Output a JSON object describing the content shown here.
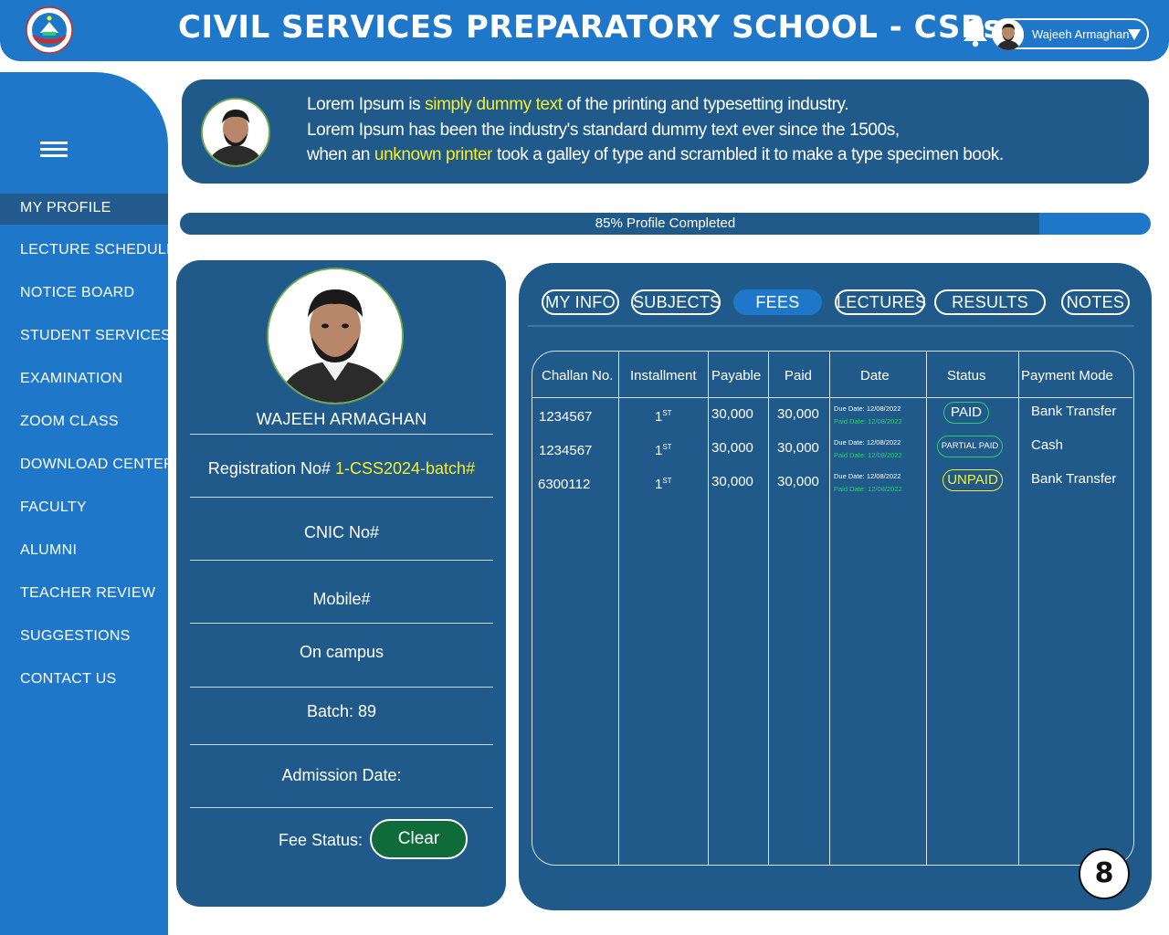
{
  "header": {
    "title": "CIVIL SERVICES PREPARATORY SCHOOL - CSPs",
    "logo_icon": "school-crest-icon",
    "notification_icon": "bell-icon",
    "user_name": "Wajeeh Armaghan",
    "user_menu_icon": "caret-down-icon"
  },
  "sidebar": {
    "menu_icon": "hamburger-icon",
    "items": [
      {
        "label": "MY PROFILE",
        "active": true
      },
      {
        "label": "LECTURE SCHEDULE"
      },
      {
        "label": "NOTICE BOARD"
      },
      {
        "label": "STUDENT SERVICES"
      },
      {
        "label": "EXAMINATION"
      },
      {
        "label": "ZOOM CLASS"
      },
      {
        "label": "DOWNLOAD CENTER"
      },
      {
        "label": "FACULTY"
      },
      {
        "label": "ALUMNI"
      },
      {
        "label": "TEACHER REVIEW"
      },
      {
        "label": "SUGGESTIONS"
      },
      {
        "label": "CONTACT US"
      }
    ]
  },
  "banner": {
    "line1_a": "Lorem Ipsum is ",
    "line1_hl": "simply dummy text",
    "line1_b": " of the printing and typesetting industry.",
    "line2": "Lorem Ipsum has been the industry's  standard dummy text ever since the 1500s,",
    "line3_a": "when an ",
    "line3_hl": "unknown printer",
    "line3_b": " took a galley  of type and scrambled it to make a type specimen book."
  },
  "progress": {
    "label": "85% Profile Completed",
    "value": 0.885
  },
  "profile": {
    "name": "WAJEEH ARMAGHAN",
    "registration_label": "Registration No# ",
    "registration_value": "1-CSS2024-batch#",
    "cnic": "CNIC No#",
    "mobile": "Mobile#",
    "mode": "On campus",
    "batch": "Batch:  89",
    "admission_date": "Admission Date:",
    "fee_status_label": "Fee Status:",
    "fee_status_value": "Clear"
  },
  "tabs": [
    {
      "label": "MY INFO"
    },
    {
      "label": "SUBJECTS"
    },
    {
      "label": "FEES",
      "active": true
    },
    {
      "label": "LECTURES"
    },
    {
      "label": "RESULTS"
    },
    {
      "label": "NOTES"
    }
  ],
  "fees_table": {
    "headers": [
      "Challan No.",
      "Installment",
      "Payable",
      "Paid",
      "Date",
      "Status",
      "Payment Mode"
    ],
    "rows": [
      {
        "challan": "1234567",
        "installment": "1",
        "installment_suffix": "ST",
        "payable": "30,000",
        "paid": "30,000",
        "due_date": "Due Date:  12/08/2022",
        "paid_date": "Paid Date:  12/08/2022",
        "status": "PAID",
        "mode": "Bank Transfer"
      },
      {
        "challan": "1234567",
        "installment": "1",
        "installment_suffix": "ST",
        "payable": "30,000",
        "paid": "30,000",
        "due_date": "Due Date:  12/08/2022",
        "paid_date": "Paid Date:  12/08/2022",
        "status": "PARTIAL PAID",
        "mode": "Cash"
      },
      {
        "challan": "6300112",
        "installment": "1",
        "installment_suffix": "ST",
        "payable": "30,000",
        "paid": "30,000",
        "due_date": "Due Date:  12/08/2022",
        "paid_date": "Paid Date:  12/08/2022",
        "status": "UNPAID",
        "mode": "Bank Transfer"
      }
    ]
  },
  "page_number": "8",
  "colors": {
    "primary_blue": "#1f77c9",
    "dark_blue": "#1f5a8a",
    "highlight_yellow": "#f6ef2d",
    "status_green": "#2ecc71",
    "clear_green": "#0f6b3a"
  }
}
